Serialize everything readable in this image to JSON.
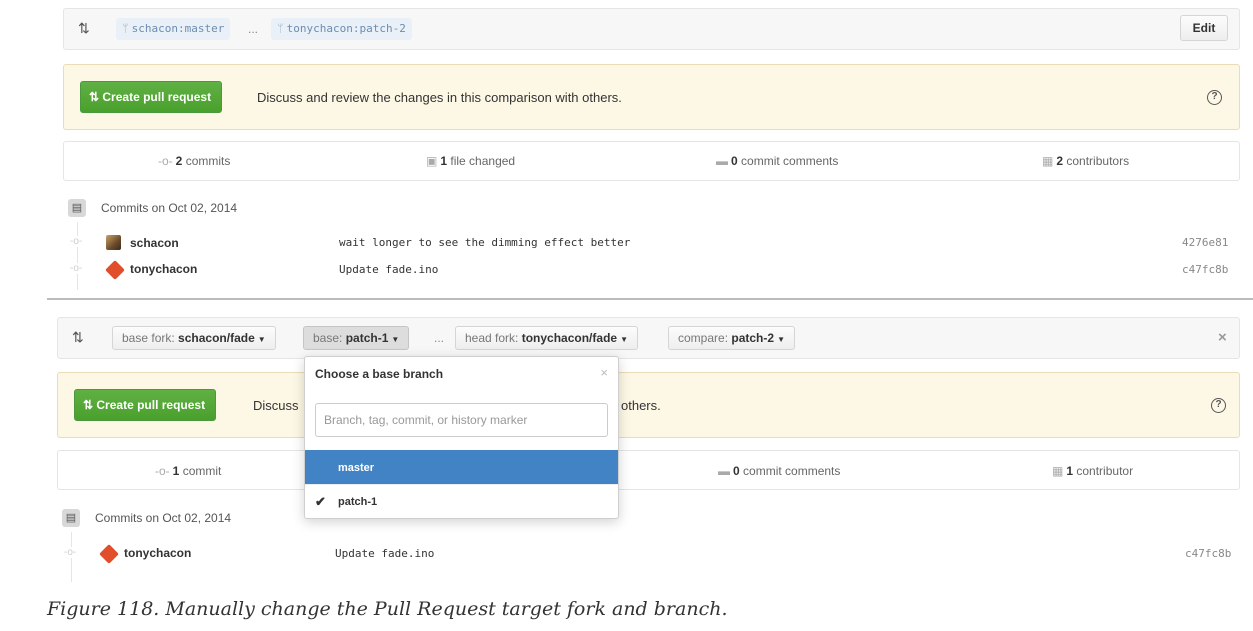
{
  "top_panel": {
    "base_branch": "schacon:master",
    "dots": "...",
    "head_branch": "tonychacon:patch-2",
    "edit_label": "Edit",
    "create_pr_label": "Create pull request",
    "flash_message": "Discuss and review the changes in this comparison with others.",
    "help_label": "?",
    "stats": {
      "commits_count": "2",
      "commits_label": "commits",
      "files_count": "1",
      "files_label": "file changed",
      "comments_count": "0",
      "comments_label": "commit comments",
      "contributors_count": "2",
      "contributors_label": "contributors"
    },
    "commits_heading": "Commits on Oct 02, 2014",
    "commits": [
      {
        "author": "schacon",
        "message": "wait longer to see the dimming effect better",
        "sha": "4276e81"
      },
      {
        "author": "tonychacon",
        "message": "Update fade.ino",
        "sha": "c47fc8b"
      }
    ]
  },
  "bottom_panel": {
    "base_fork_label": "base fork:",
    "base_fork_value": "schacon/fade",
    "base_label": "base:",
    "base_value": "patch-1",
    "dots": "...",
    "head_fork_label": "head fork:",
    "head_fork_value": "tonychacon/fade",
    "compare_label": "compare:",
    "compare_value": "patch-2",
    "close_label": "×",
    "create_pr_label": "Create pull request",
    "flash_message_start": "Discuss",
    "flash_message_end": "others.",
    "help_label": "?",
    "stats": {
      "commits_count": "1",
      "commits_label": "commit",
      "comments_count": "0",
      "comments_label": "commit comments",
      "contributors_count": "1",
      "contributors_label": "contributor"
    },
    "commits_heading": "Commits on Oct 02, 2014",
    "commits": [
      {
        "author": "tonychacon",
        "message": "Update fade.ino",
        "sha": "c47fc8b"
      }
    ],
    "dropdown": {
      "title": "Choose a base branch",
      "close_label": "×",
      "filter_placeholder": "Branch, tag, commit, or history marker",
      "items": [
        {
          "label": "master",
          "highlighted": true,
          "checked": false
        },
        {
          "label": "patch-1",
          "highlighted": false,
          "checked": true
        }
      ]
    }
  },
  "caption": "Figure 118. Manually change the Pull Request target fork and branch.",
  "colors": {
    "accent_green": "#55a532",
    "flash_bg": "#fdf8e5",
    "highlight_blue": "#4183c4"
  }
}
